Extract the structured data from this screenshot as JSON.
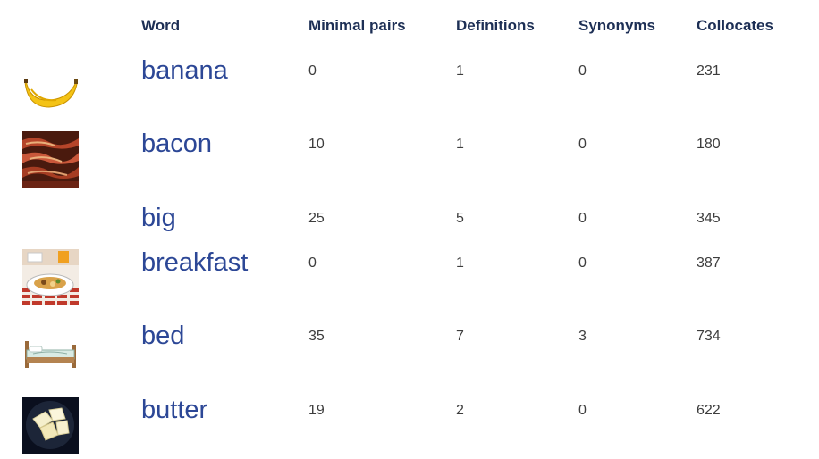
{
  "headers": {
    "word": "Word",
    "minimal_pairs": "Minimal pairs",
    "definitions": "Definitions",
    "synonyms": "Synonyms",
    "collocates": "Collocates"
  },
  "rows": [
    {
      "word": "banana",
      "minimal_pairs": "0",
      "definitions": "1",
      "synonyms": "0",
      "collocates": "231",
      "image": "banana-icon"
    },
    {
      "word": "bacon",
      "minimal_pairs": "10",
      "definitions": "1",
      "synonyms": "0",
      "collocates": "180",
      "image": "bacon-photo"
    },
    {
      "word": "big",
      "minimal_pairs": "25",
      "definitions": "5",
      "synonyms": "0",
      "collocates": "345",
      "image": ""
    },
    {
      "word": "breakfast",
      "minimal_pairs": "0",
      "definitions": "1",
      "synonyms": "0",
      "collocates": "387",
      "image": "breakfast-photo"
    },
    {
      "word": "bed",
      "minimal_pairs": "35",
      "definitions": "7",
      "synonyms": "3",
      "collocates": "734",
      "image": "bed-icon"
    },
    {
      "word": "butter",
      "minimal_pairs": "19",
      "definitions": "2",
      "synonyms": "0",
      "collocates": "622",
      "image": "butter-photo"
    }
  ],
  "colors": {
    "header": "#1d2f55",
    "word_link": "#2c4796",
    "numbers": "#3d3d3d"
  }
}
